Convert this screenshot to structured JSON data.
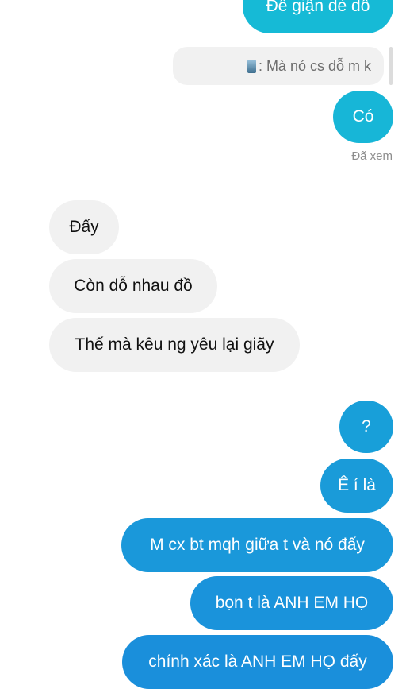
{
  "colors": {
    "outgoing_top": "#18b4d8",
    "outgoing_bottom": "#1a8fdb",
    "incoming_bg": "#f1f1f1"
  },
  "messages": {
    "cut_top": "Để giận dè dỗ",
    "reply_quote": ": Mà nó cs dỗ m k",
    "m1": "Có",
    "seen": "Đã xem",
    "in1": "Đấy",
    "in2": "Còn dỗ nhau đồ",
    "in3": "Thế mà kêu ng yêu lại giãy",
    "m2": "?",
    "m3": "Ê í là",
    "m4": "M cx bt mqh giữa t và nó đấy",
    "m5": "bọn t là ANH EM HỌ",
    "m6": "chính xác là ANH EM HỌ đấy"
  }
}
